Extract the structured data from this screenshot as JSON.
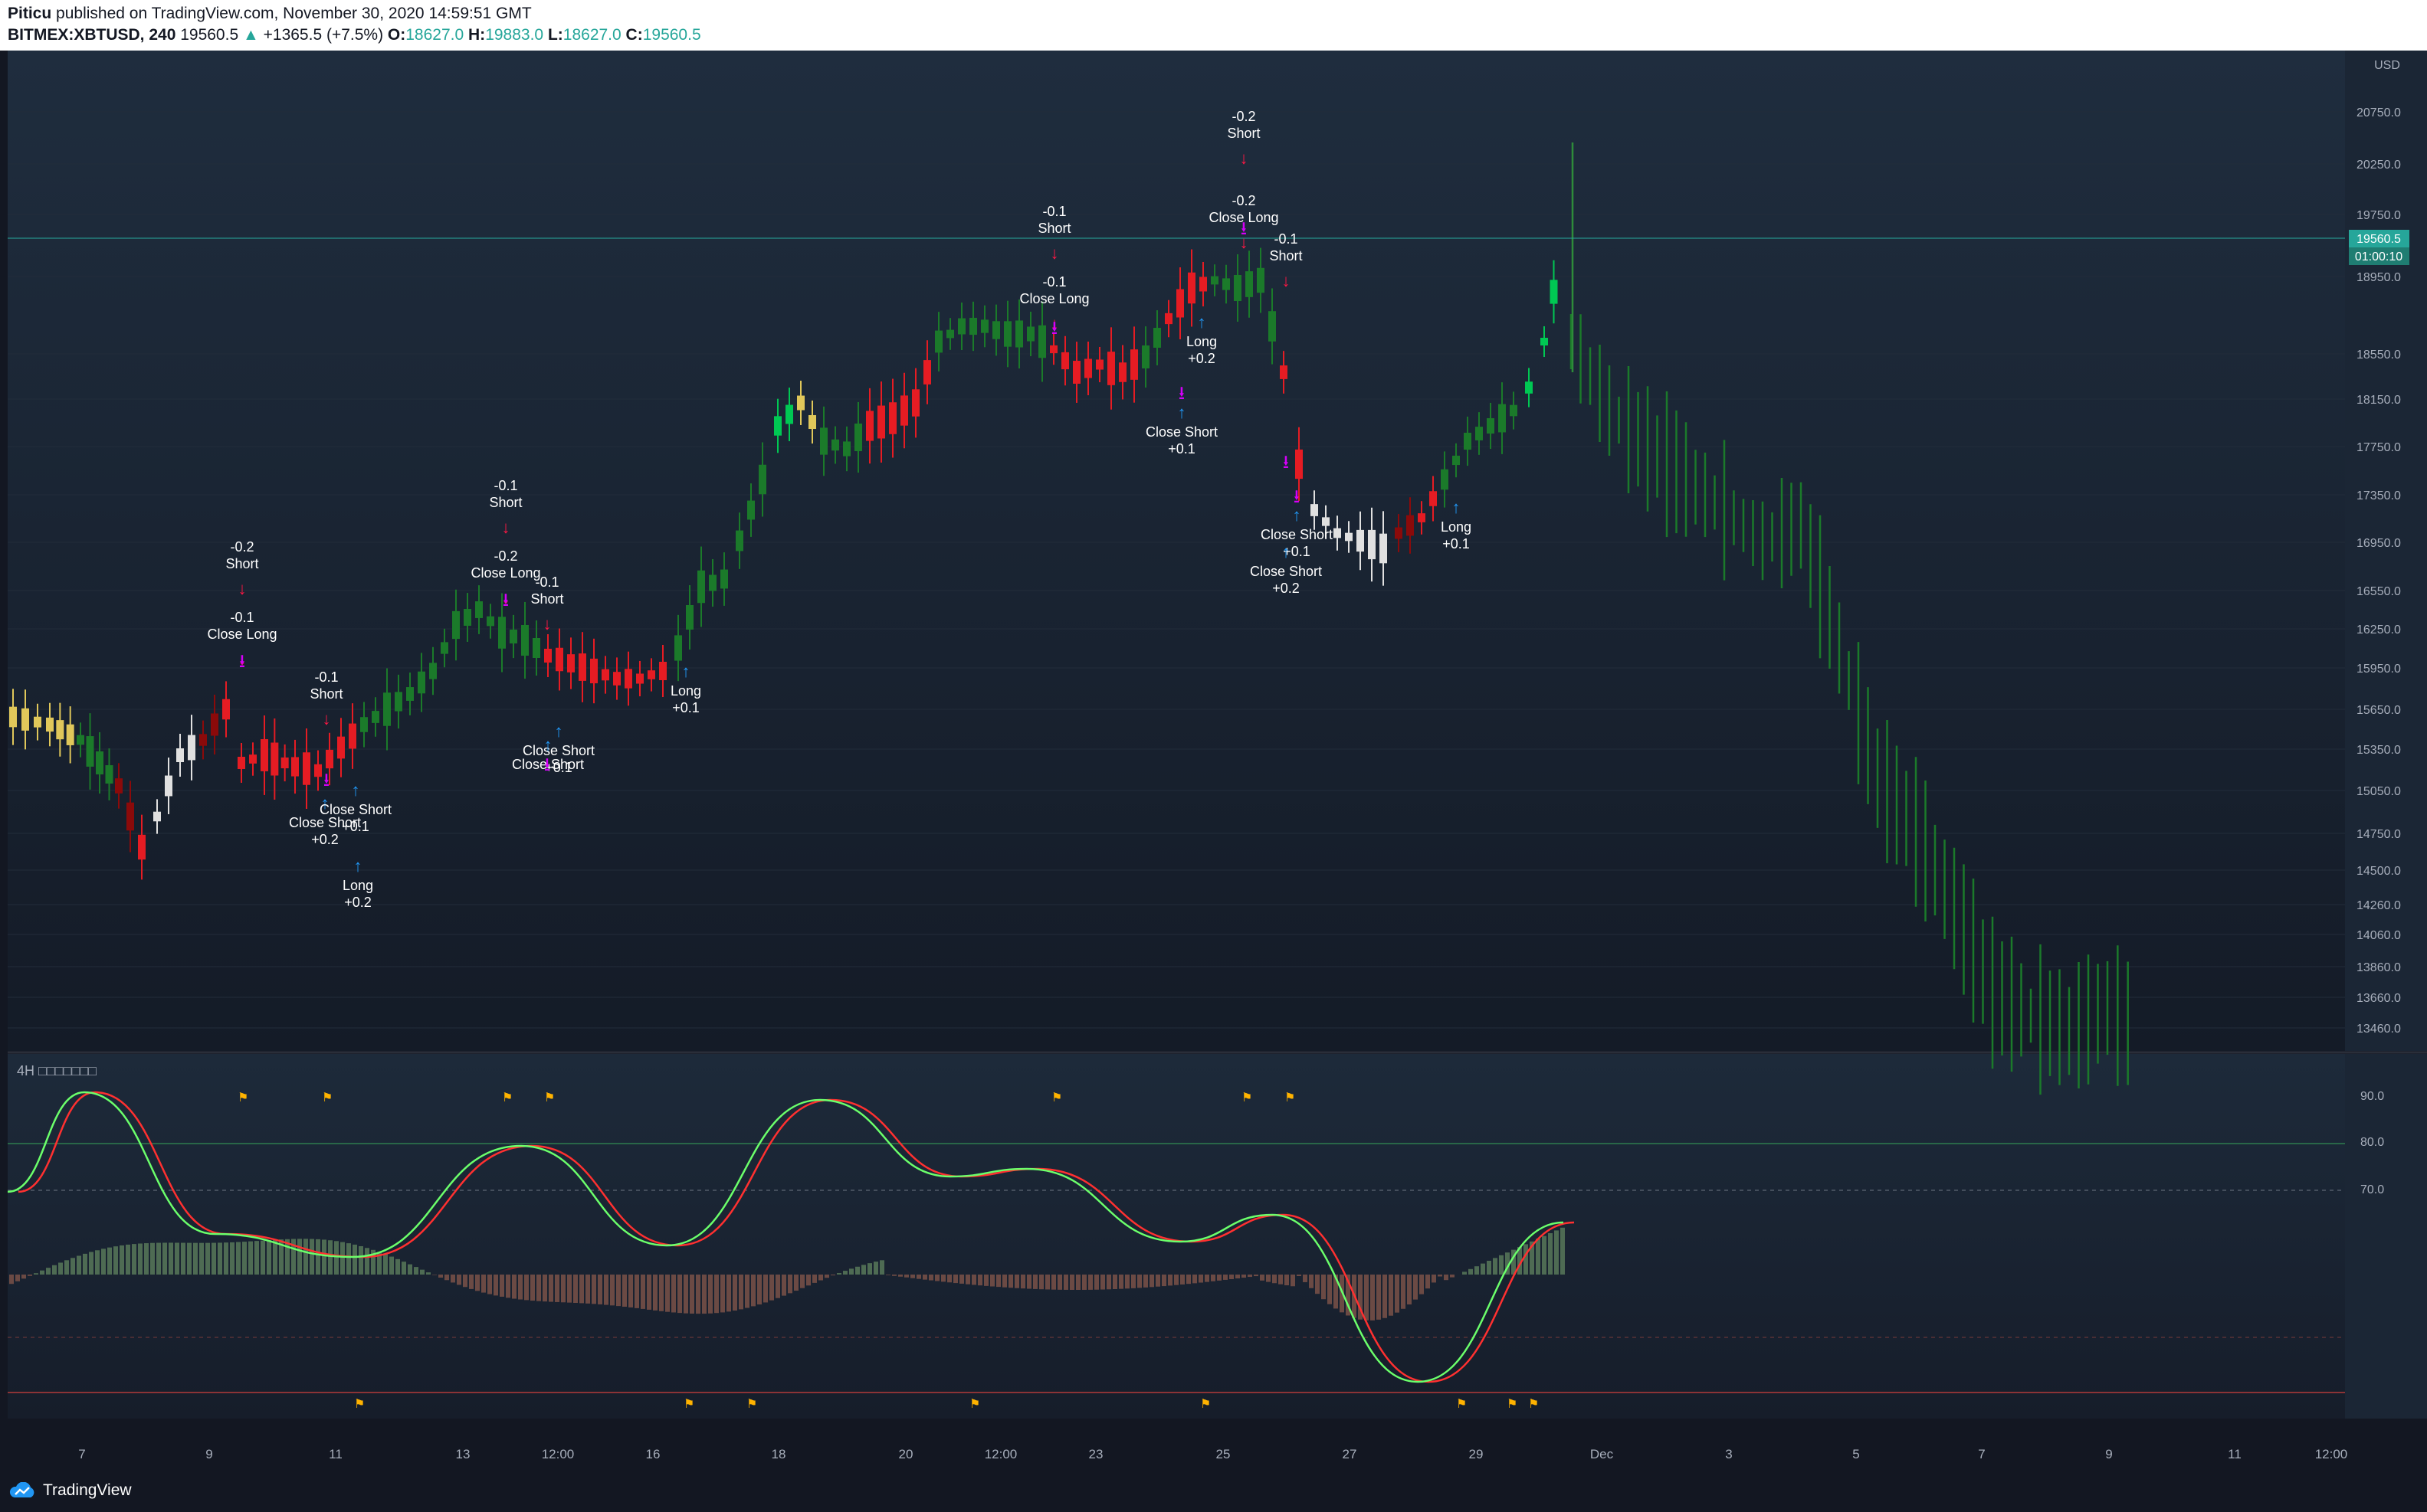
{
  "header": {
    "author": "Piticu",
    "published": "published on TradingView.com, November 30, 2020 14:59:51 GMT",
    "symbol": "BITMEX:XBTUSD, 240",
    "last": "19560.5",
    "change": "+1365.5 (+7.5%)",
    "ohlc": [
      {
        "label": "O:",
        "value": "18627.0"
      },
      {
        "label": "H:",
        "value": "19883.0"
      },
      {
        "label": "L:",
        "value": "18627.0"
      },
      {
        "label": "C:",
        "value": "19560.5"
      }
    ]
  },
  "price_axis": {
    "currency": "USD",
    "labels": [
      "20750.0",
      "20250.0",
      "19750.0",
      "18950.0",
      "18550.0",
      "18150.0",
      "17750.0",
      "17350.0",
      "16950.0",
      "16550.0",
      "16250.0",
      "15950.0",
      "15650.0",
      "15350.0",
      "15050.0",
      "14750.0",
      "14500.0",
      "14260.0",
      "14060.0",
      "13860.0",
      "13660.0",
      "13460.0"
    ],
    "current_price": "19560.5",
    "countdown": "01:00:10"
  },
  "oscillator": {
    "title": "4H □□□□□□□",
    "levels": [
      "90.0",
      "80.0",
      "70.0"
    ]
  },
  "time_axis": {
    "labels": [
      "7",
      "9",
      "11",
      "13",
      "12:00",
      "16",
      "18",
      "20",
      "12:00",
      "23",
      "25",
      "27",
      "29",
      "Dec",
      "3",
      "5",
      "7",
      "9",
      "11",
      "12:00"
    ]
  },
  "signals": [
    {
      "id": "s1",
      "lines": [
        "-0.2",
        "Short"
      ],
      "color": "#ffffff"
    },
    {
      "id": "s2",
      "lines": [
        "-0.1",
        "Close Long"
      ],
      "color": "#ffffff"
    },
    {
      "id": "s3",
      "lines": [
        "-0.1",
        "Short"
      ],
      "color": "#ffffff"
    },
    {
      "id": "s4",
      "lines": [
        "Close Short",
        "+0.2"
      ],
      "color": "#ffffff"
    },
    {
      "id": "s5",
      "lines": [
        "Close Short",
        "+0.1"
      ],
      "color": "#ffffff"
    },
    {
      "id": "s6",
      "lines": [
        "Long",
        "+0.2"
      ],
      "color": "#ffffff"
    },
    {
      "id": "s7",
      "lines": [
        "-0.1",
        "Short"
      ],
      "color": "#ffffff"
    },
    {
      "id": "s8",
      "lines": [
        "-0.2",
        "Close Long"
      ],
      "color": "#ffffff"
    },
    {
      "id": "s9",
      "lines": [
        "-0.1",
        "Short"
      ],
      "color": "#ffffff"
    },
    {
      "id": "s10",
      "lines": [
        "Close Short",
        "+0.1"
      ],
      "color": "#ffffff"
    },
    {
      "id": "s11",
      "lines": [
        "Close Short"
      ],
      "color": "#ffffff"
    },
    {
      "id": "s12",
      "lines": [
        "Long",
        "+0.1"
      ],
      "color": "#ffffff"
    },
    {
      "id": "s13",
      "lines": [
        "-0.1",
        "Short"
      ],
      "color": "#ffffff"
    },
    {
      "id": "s14",
      "lines": [
        "-0.1",
        "Close Long"
      ],
      "color": "#ffffff"
    },
    {
      "id": "s15",
      "lines": [
        "-0.2",
        "Short"
      ],
      "color": "#ffffff"
    },
    {
      "id": "s16",
      "lines": [
        "-0.2",
        "Close Long"
      ],
      "color": "#ffffff"
    },
    {
      "id": "s17",
      "lines": [
        "-0.1",
        "Short"
      ],
      "color": "#ffffff"
    },
    {
      "id": "s18",
      "lines": [
        "Long",
        "+0.2"
      ],
      "color": "#ffffff"
    },
    {
      "id": "s19",
      "lines": [
        "Close Short",
        "+0.1"
      ],
      "color": "#ffffff"
    },
    {
      "id": "s20",
      "lines": [
        "Close Short",
        "+0.1"
      ],
      "color": "#ffffff"
    },
    {
      "id": "s21",
      "lines": [
        "Close Short",
        "+0.2"
      ],
      "color": "#ffffff"
    },
    {
      "id": "s22",
      "lines": [
        "Long",
        "+0.1"
      ],
      "color": "#ffffff"
    }
  ],
  "footer": {
    "brand": "TradingView"
  },
  "colors": {
    "bull": "#00c853",
    "bull_dark": "#1b7a2a",
    "bear": "#e51c23",
    "bear_dark": "#8b0a0a",
    "neutral": "#e0e0e0",
    "yellow": "#e0c75a",
    "teal": "#26a69a",
    "magenta": "#d500f9",
    "blue": "#2196f3"
  }
}
